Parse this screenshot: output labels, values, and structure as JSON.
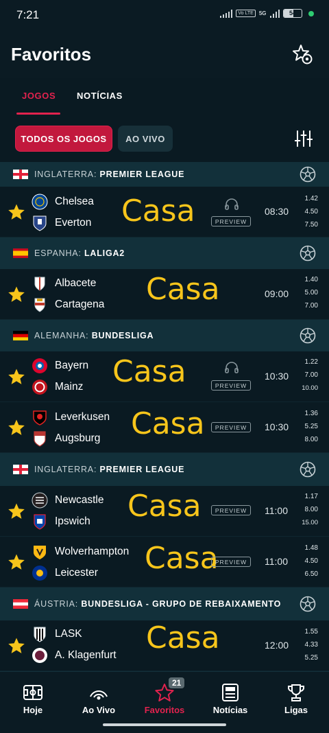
{
  "status": {
    "time": "7:21",
    "battery": "54",
    "net_tag": "Vo LTE",
    "net_5g": "5G"
  },
  "header": {
    "title": "Favoritos"
  },
  "tabs": [
    {
      "label": "JOGOS"
    },
    {
      "label": "NOTÍCIAS"
    }
  ],
  "filters": {
    "all": "TODOS OS JOGOS",
    "live": "AO VIVO"
  },
  "overlay_text": "Casa",
  "preview_label": "PREVIEW",
  "leagues": [
    {
      "country": "INGLATERRA:",
      "name": "PREMIER LEAGUE"
    },
    {
      "country": "ESPANHA:",
      "name": "LALIGA2"
    },
    {
      "country": "ALEMANHA:",
      "name": "BUNDESLIGA"
    },
    {
      "country": "INGLATERRA:",
      "name": "PREMIER LEAGUE"
    },
    {
      "country": "ÁUSTRIA:",
      "name": "BUNDESLIGA - GRUPO DE REBAIXAMENTO"
    }
  ],
  "matches": [
    {
      "home": "Chelsea",
      "away": "Everton",
      "time": "08:30",
      "odds": [
        "1.42",
        "4.50",
        "7.50"
      ]
    },
    {
      "home": "Albacete",
      "away": "Cartagena",
      "time": "09:00",
      "odds": [
        "1.40",
        "5.00",
        "7.00"
      ]
    },
    {
      "home": "Bayern",
      "away": "Mainz",
      "time": "10:30",
      "odds": [
        "1.22",
        "7.00",
        "10.00"
      ]
    },
    {
      "home": "Leverkusen",
      "away": "Augsburg",
      "time": "10:30",
      "odds": [
        "1.36",
        "5.25",
        "8.00"
      ]
    },
    {
      "home": "Newcastle",
      "away": "Ipswich",
      "time": "11:00",
      "odds": [
        "1.17",
        "8.00",
        "15.00"
      ]
    },
    {
      "home": "Wolverhampton",
      "away": "Leicester",
      "time": "11:00",
      "odds": [
        "1.48",
        "4.50",
        "6.50"
      ]
    },
    {
      "home": "LASK",
      "away": "A. Klagenfurt",
      "time": "12:00",
      "odds": [
        "1.55",
        "4.33",
        "5.25"
      ]
    }
  ],
  "nav": [
    {
      "label": "Hoje"
    },
    {
      "label": "Ao Vivo"
    },
    {
      "label": "Favoritos",
      "badge": "21"
    },
    {
      "label": "Notícias"
    },
    {
      "label": "Ligas"
    }
  ],
  "colors": {
    "accent": "#e2224e",
    "casa": "#f7c51b",
    "star": "#f7c51b"
  }
}
